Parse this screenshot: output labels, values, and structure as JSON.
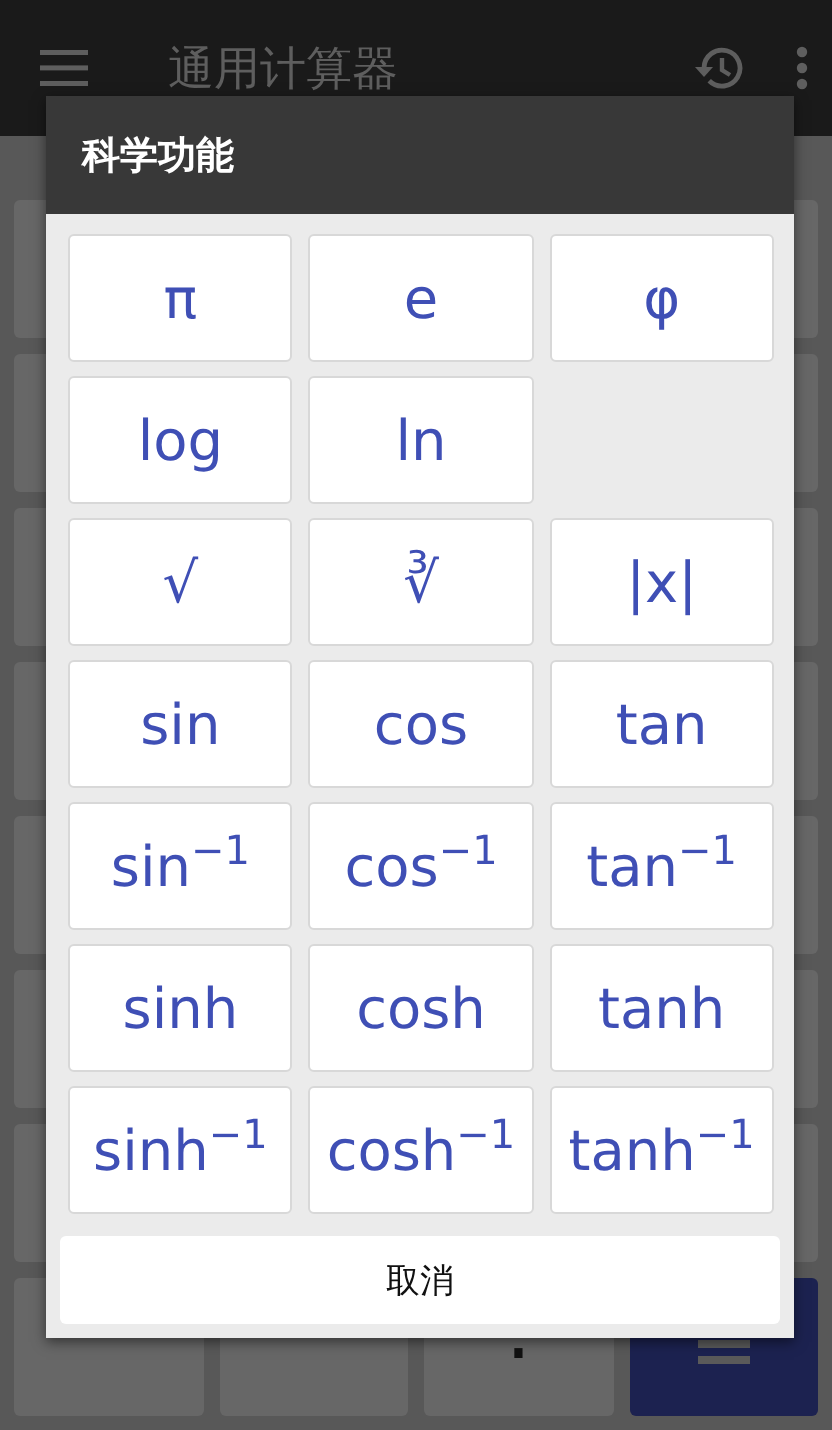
{
  "app_bar": {
    "title": "通用计算器"
  },
  "background_keys": [
    {
      "kind": "blank"
    },
    {
      "kind": "blank"
    },
    {
      "label": ".",
      "kind": "digit"
    },
    {
      "kind": "equals"
    }
  ],
  "dialog": {
    "title": "科学功能",
    "buttons": [
      {
        "label": "π",
        "kind": "key"
      },
      {
        "label": "e",
        "kind": "key"
      },
      {
        "label": "φ",
        "kind": "key"
      },
      {
        "label": "log",
        "kind": "key"
      },
      {
        "label": "ln",
        "kind": "key"
      },
      {
        "kind": "empty"
      },
      {
        "label": "√",
        "kind": "key"
      },
      {
        "label": "∛",
        "kind": "key"
      },
      {
        "label": "|x|",
        "kind": "key"
      },
      {
        "label": "sin",
        "kind": "key"
      },
      {
        "label": "cos",
        "kind": "key"
      },
      {
        "label": "tan",
        "kind": "key"
      },
      {
        "label": "sin$^{−1}$",
        "kind": "key"
      },
      {
        "label": "cos$^{−1}$",
        "kind": "key"
      },
      {
        "label": "tan$^{−1}$",
        "kind": "key"
      },
      {
        "label": "sinh",
        "kind": "key"
      },
      {
        "label": "cosh",
        "kind": "key"
      },
      {
        "label": "tanh",
        "kind": "key"
      },
      {
        "label": "sinh$^{−1}$",
        "kind": "key"
      },
      {
        "label": "cosh$^{−1}$",
        "kind": "key"
      },
      {
        "label": "tanh$^{−1}$",
        "kind": "key"
      }
    ],
    "cancel": "取消"
  }
}
